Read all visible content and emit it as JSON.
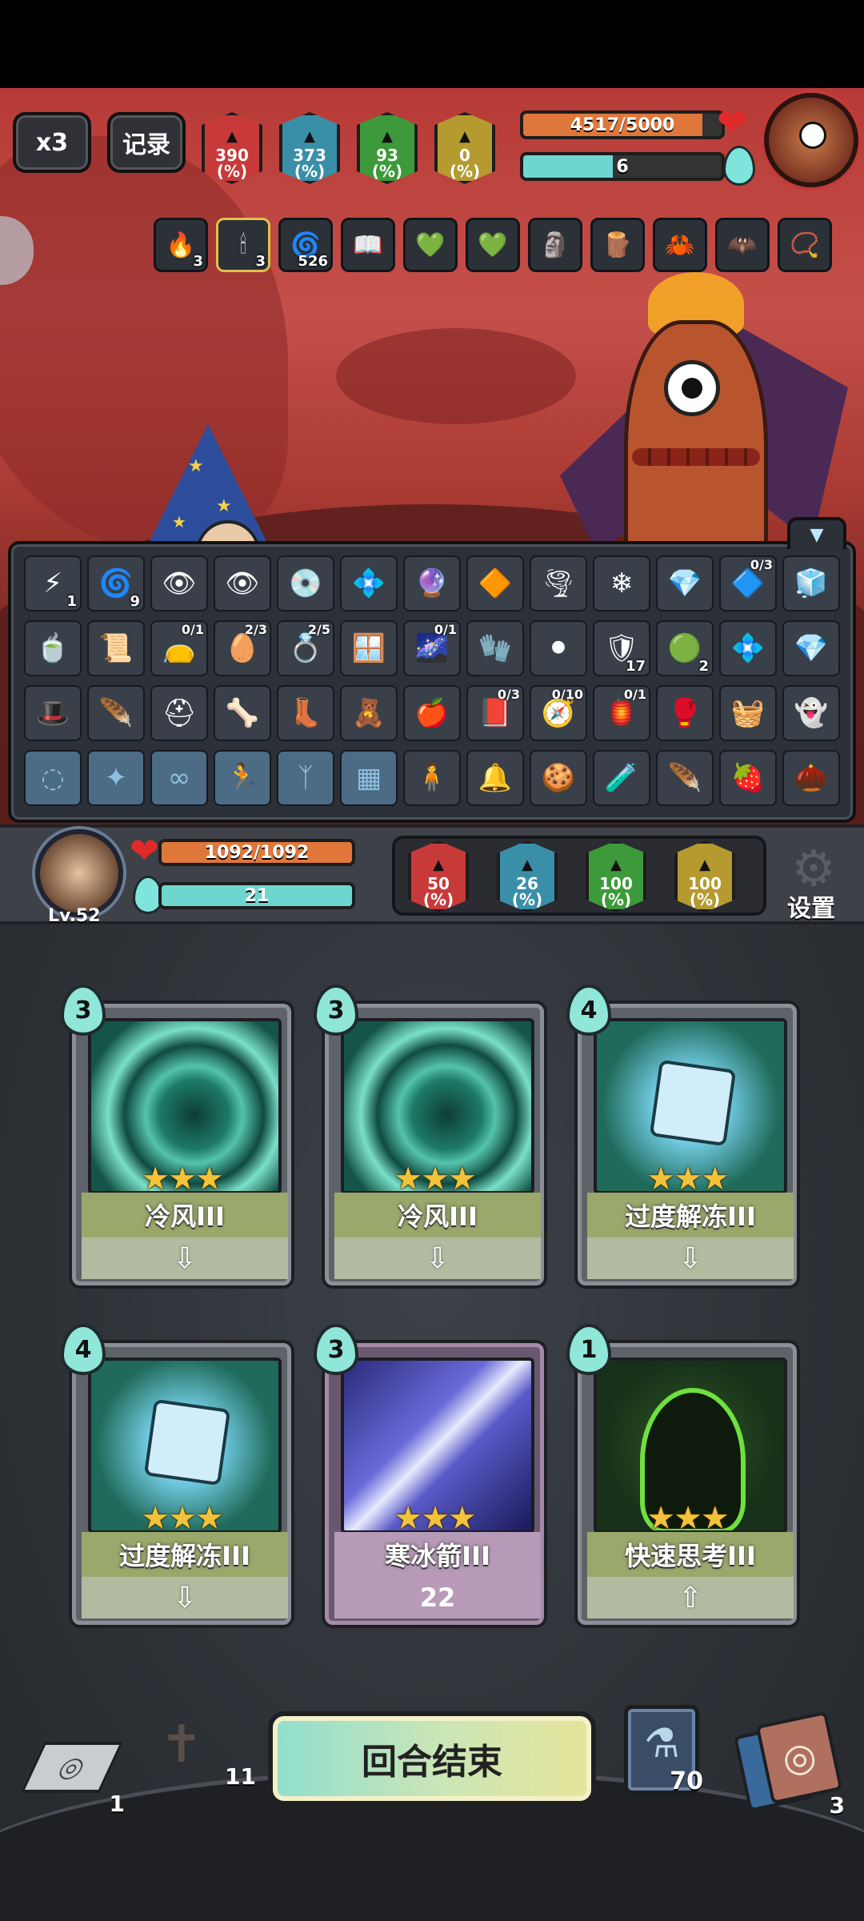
{
  "top_controls": {
    "speed_label": "x3",
    "record_label": "记录"
  },
  "enemy": {
    "stats": [
      {
        "value": "390",
        "unit": "(%)",
        "color": "#c83a3a",
        "icon": "attack-stat-icon"
      },
      {
        "value": "373",
        "unit": "(%)",
        "color": "#3a8fa8",
        "icon": "magic-stat-icon"
      },
      {
        "value": "93",
        "unit": "(%)",
        "color": "#3c9a3a",
        "icon": "defense-stat-icon"
      },
      {
        "value": "0",
        "unit": "(%)",
        "color": "#b59a30",
        "icon": "resist-stat-icon"
      }
    ],
    "hp_text": "4517/5000",
    "hp_fraction": 0.9034,
    "mana_text": "6",
    "mana_fraction": 0.45,
    "buffs": [
      {
        "icon": "fire-icon",
        "glyph": "🔥",
        "count": "3"
      },
      {
        "icon": "candle-icon",
        "glyph": "🕯",
        "count": "3"
      },
      {
        "icon": "spiral-icon",
        "glyph": "🌀",
        "count": "526"
      },
      {
        "icon": "book-icon",
        "glyph": "📖",
        "count": ""
      },
      {
        "icon": "green-gem-icon",
        "glyph": "💚",
        "count": ""
      },
      {
        "icon": "green-gem-icon",
        "glyph": "💚",
        "count": ""
      },
      {
        "icon": "statue-icon",
        "glyph": "🗿",
        "count": ""
      },
      {
        "icon": "torch-icon",
        "glyph": "🪵",
        "count": ""
      },
      {
        "icon": "claw-icon",
        "glyph": "🦀",
        "count": ""
      },
      {
        "icon": "wing-icon",
        "glyph": "🦇",
        "count": ""
      },
      {
        "icon": "beads-icon",
        "glyph": "📿",
        "count": ""
      }
    ]
  },
  "inventory": {
    "rows": [
      [
        {
          "icon": "lightning-icon",
          "glyph": "⚡",
          "count": "1",
          "frac": ""
        },
        {
          "icon": "spiral-icon",
          "glyph": "🌀",
          "count": "9",
          "frac": ""
        },
        {
          "icon": "eye-icon",
          "glyph": "👁",
          "count": "",
          "frac": ""
        },
        {
          "icon": "eye-icon",
          "glyph": "👁",
          "count": "",
          "frac": ""
        },
        {
          "icon": "disc-icon",
          "glyph": "💿",
          "count": "",
          "frac": ""
        },
        {
          "icon": "blue-gem-icon",
          "glyph": "💠",
          "count": "",
          "frac": ""
        },
        {
          "icon": "purple-crystal-icon",
          "glyph": "🔮",
          "count": "",
          "frac": ""
        },
        {
          "icon": "orange-crystal-icon",
          "glyph": "🔶",
          "count": "",
          "frac": ""
        },
        {
          "icon": "swirl-icon",
          "glyph": "🌪",
          "count": "",
          "frac": ""
        },
        {
          "icon": "rune-icon",
          "glyph": "❄",
          "count": "",
          "frac": ""
        },
        {
          "icon": "ice-crystal-icon",
          "glyph": "💎",
          "count": "",
          "frac": ""
        },
        {
          "icon": "prism-icon",
          "glyph": "🔷",
          "count": "",
          "frac": "0/3"
        },
        {
          "icon": "frost-icon",
          "glyph": "🧊",
          "count": "",
          "frac": ""
        }
      ],
      [
        {
          "icon": "cauldron-icon",
          "glyph": "🍵",
          "count": "",
          "frac": ""
        },
        {
          "icon": "red-scroll-icon",
          "glyph": "📜",
          "count": "",
          "frac": ""
        },
        {
          "icon": "bag-icon",
          "glyph": "👝",
          "count": "",
          "frac": "0/1"
        },
        {
          "icon": "egg-icon",
          "glyph": "🥚",
          "count": "",
          "frac": "2/3"
        },
        {
          "icon": "ring-icon",
          "glyph": "💍",
          "count": "",
          "frac": "2/5"
        },
        {
          "icon": "frame-icon",
          "glyph": "🪟",
          "count": "",
          "frac": ""
        },
        {
          "icon": "galaxy-icon",
          "glyph": "🌌",
          "count": "",
          "frac": "0/1"
        },
        {
          "icon": "glove-icon",
          "glyph": "🧤",
          "count": "",
          "frac": ""
        },
        {
          "icon": "orb-icon",
          "glyph": "⚫",
          "count": "",
          "frac": ""
        },
        {
          "icon": "shield-icon",
          "glyph": "🛡",
          "count": "17",
          "frac": ""
        },
        {
          "icon": "slime-icon",
          "glyph": "🟢",
          "count": "2",
          "frac": ""
        },
        {
          "icon": "gem-icon",
          "glyph": "💠",
          "count": "",
          "frac": ""
        },
        {
          "icon": "blue-crystal-icon",
          "glyph": "💎",
          "count": "",
          "frac": ""
        }
      ],
      [
        {
          "icon": "hat-icon",
          "glyph": "🎩",
          "count": "",
          "frac": ""
        },
        {
          "icon": "wings-icon",
          "glyph": "🪶",
          "count": "",
          "frac": ""
        },
        {
          "icon": "helmet-icon",
          "glyph": "⛑",
          "count": "",
          "frac": ""
        },
        {
          "icon": "claw-icon",
          "glyph": "🦴",
          "count": "",
          "frac": ""
        },
        {
          "icon": "boot-icon",
          "glyph": "👢",
          "count": "",
          "frac": ""
        },
        {
          "icon": "doll-icon",
          "glyph": "🧸",
          "count": "",
          "frac": ""
        },
        {
          "icon": "fruit-icon",
          "glyph": "🍎",
          "count": "",
          "frac": ""
        },
        {
          "icon": "tome-icon",
          "glyph": "📕",
          "count": "",
          "frac": "0/3"
        },
        {
          "icon": "compass-icon",
          "glyph": "🧭",
          "count": "",
          "frac": "0/10"
        },
        {
          "icon": "lantern-icon",
          "glyph": "🏮",
          "count": "",
          "frac": "0/1"
        },
        {
          "icon": "gauntlet-icon",
          "glyph": "🥊",
          "count": "",
          "frac": ""
        },
        {
          "icon": "sack-icon",
          "glyph": "🧺",
          "count": "",
          "frac": ""
        },
        {
          "icon": "ghost-icon",
          "glyph": "👻",
          "count": "",
          "frac": ""
        }
      ],
      [
        {
          "icon": "swirl-rune-icon",
          "glyph": "◌",
          "count": "",
          "frac": ""
        },
        {
          "icon": "staff-rune-icon",
          "glyph": "✦",
          "count": "",
          "frac": ""
        },
        {
          "icon": "chain-rune-icon",
          "glyph": "∞",
          "count": "",
          "frac": ""
        },
        {
          "icon": "runner-rune-icon",
          "glyph": "🏃",
          "count": "",
          "frac": ""
        },
        {
          "icon": "wing-rune-icon",
          "glyph": "ᛉ",
          "count": "",
          "frac": ""
        },
        {
          "icon": "box-rune-icon",
          "glyph": "▦",
          "count": "",
          "frac": ""
        },
        {
          "icon": "figure-icon",
          "glyph": "🧍",
          "count": "",
          "frac": ""
        },
        {
          "icon": "bell-icon",
          "glyph": "🔔",
          "count": "",
          "frac": ""
        },
        {
          "icon": "cookie-icon",
          "glyph": "🍪",
          "count": "",
          "frac": ""
        },
        {
          "icon": "potion-icon",
          "glyph": "🧪",
          "count": "",
          "frac": ""
        },
        {
          "icon": "feather-icon",
          "glyph": "🪶",
          "count": "",
          "frac": ""
        },
        {
          "icon": "strawberry-icon",
          "glyph": "🍓",
          "count": "",
          "frac": ""
        },
        {
          "icon": "cone-icon",
          "glyph": "🌰",
          "count": "",
          "frac": ""
        }
      ]
    ]
  },
  "player": {
    "level": "Lv.52",
    "hp_text": "1092/1092",
    "hp_fraction": 1.0,
    "mana_text": "21",
    "mana_fraction": 1.0,
    "stats": [
      {
        "value": "50",
        "unit": "(%)",
        "color": "#c83a3a",
        "icon": "attack-stat-icon"
      },
      {
        "value": "26",
        "unit": "(%)",
        "color": "#3a8fa8",
        "icon": "magic-stat-icon"
      },
      {
        "value": "100",
        "unit": "(%)",
        "color": "#3c9a3a",
        "icon": "defense-stat-icon"
      },
      {
        "value": "100",
        "unit": "(%)",
        "color": "#b59a30",
        "icon": "resist-stat-icon"
      }
    ],
    "settings_label": "设置"
  },
  "cards": [
    {
      "cost": "3",
      "name": "冷风III",
      "stars": "★★★",
      "footer": "⇩",
      "art": "wind-vortex",
      "name_bg": "#9aa86b",
      "foot_bg": "#b2bba0"
    },
    {
      "cost": "3",
      "name": "冷风III",
      "stars": "★★★",
      "footer": "⇩",
      "art": "wind-vortex",
      "name_bg": "#9aa86b",
      "foot_bg": "#b2bba0"
    },
    {
      "cost": "4",
      "name": "过度解冻III",
      "stars": "★★★",
      "footer": "⇩",
      "art": "ice-cube",
      "name_bg": "#9aa86b",
      "foot_bg": "#b2bba0"
    },
    {
      "cost": "4",
      "name": "过度解冻III",
      "stars": "★★★",
      "footer": "⇩",
      "art": "ice-cube",
      "name_bg": "#9aa86b",
      "foot_bg": "#b2bba0"
    },
    {
      "cost": "3",
      "name": "寒冰箭III",
      "stars": "★★★",
      "footer": "22",
      "art": "ice-arrow",
      "name_bg": "#b69ab8",
      "foot_bg": "#b89ab9"
    },
    {
      "cost": "1",
      "name": "快速思考III",
      "stars": "★★★",
      "footer": "⇧",
      "art": "think",
      "name_bg": "#9aa86b",
      "foot_bg": "#b2bba0"
    }
  ],
  "bottom": {
    "draw_pile_count": "1",
    "graveyard_count": "11",
    "end_turn_label": "回合结束",
    "potion_count": "70",
    "discard_count": "3"
  }
}
